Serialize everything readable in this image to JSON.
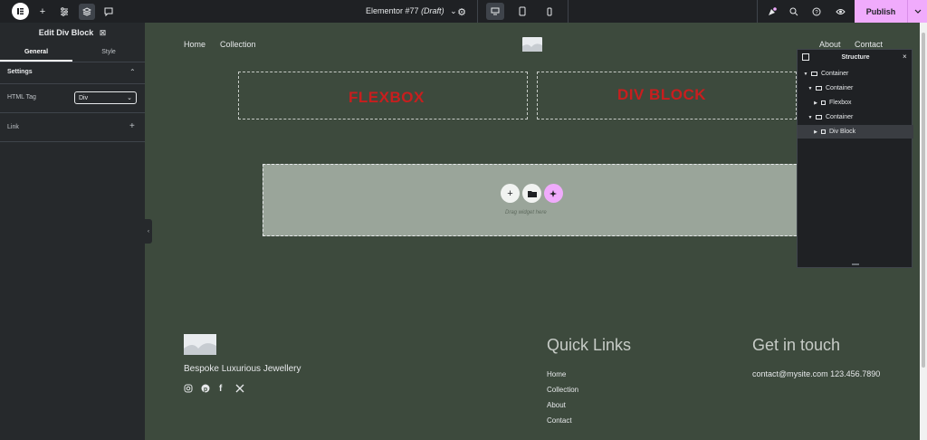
{
  "topbar": {
    "document_name": "Elementor #77",
    "document_status": "(Draft)",
    "publish_label": "Publish"
  },
  "panel": {
    "title": "Edit Div Block",
    "tabs": [
      "General",
      "Style"
    ],
    "section_settings": "Settings",
    "html_tag_label": "HTML Tag",
    "html_tag_value": "Div",
    "link_label": "Link"
  },
  "site": {
    "nav_left": [
      "Home",
      "Collection"
    ],
    "nav_right": [
      "About",
      "Contact"
    ],
    "flexbox_text": "FLEXBOX",
    "divblock_text": "DIV BLOCK",
    "drag_text": "Drag widget here"
  },
  "structure": {
    "title": "Structure",
    "items": [
      "Container",
      "Container",
      "Flexbox",
      "Container",
      "Div Block"
    ]
  },
  "footer": {
    "tagline": "Bespoke Luxurious Jewellery",
    "quick_links_heading": "Quick Links",
    "quick_links": [
      "Home",
      "Collection",
      "About",
      "Contact"
    ],
    "contact_heading": "Get in touch",
    "contact_text": "contact@mysite.com 123.456.7890"
  },
  "colors": {
    "accent": "#f0abfc",
    "canvas_bg": "#3d4a3d",
    "panel_bg": "#26292c",
    "widget_text": "#c81e1e"
  }
}
